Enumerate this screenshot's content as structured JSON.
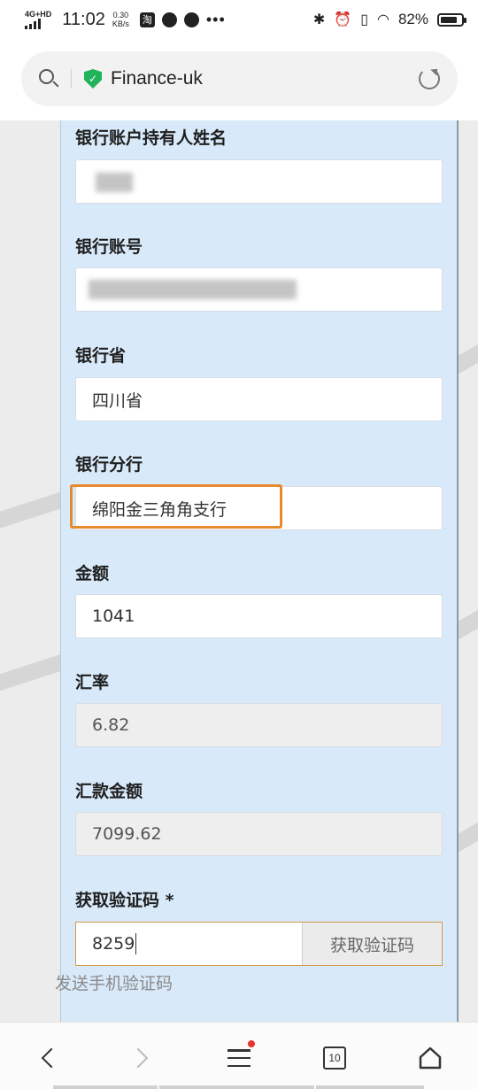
{
  "status_bar": {
    "network": "4G+HD",
    "time": "11:02",
    "speed_value": "0.30",
    "speed_unit": "KB/s",
    "taobao_glyph": "淘",
    "more": "•••",
    "battery": "82%",
    "battery_level": 0.82,
    "icons": [
      "signal-icon",
      "taobao-icon",
      "compass-icon",
      "chat-icon",
      "bluetooth-icon",
      "alarm-icon",
      "vibrate-icon",
      "wifi-icon",
      "battery-icon"
    ]
  },
  "browser": {
    "url": "Finance-uk",
    "secure_glyph": "✓"
  },
  "form": {
    "account_holder": {
      "label": "银行账户持有人姓名",
      "value": ""
    },
    "account_number": {
      "label": "银行账号",
      "value": ""
    },
    "province": {
      "label": "银行省",
      "value": "四川省"
    },
    "branch": {
      "label": "银行分行",
      "value": "绵阳金三角角支行"
    },
    "amount": {
      "label": "金额",
      "value": "1041"
    },
    "rate": {
      "label": "汇率",
      "value": "6.82"
    },
    "remit_amount": {
      "label": "汇款金额",
      "value": "7099.62"
    },
    "captcha": {
      "label": "获取验证码 *",
      "value": "8259",
      "button": "获取验证码",
      "hint": "发送手机验证码"
    }
  },
  "bottom_nav": {
    "tab_count": "10"
  },
  "colors": {
    "panel": "#d8e9f9",
    "highlight": "#e78a2e",
    "secure": "#1fb35a",
    "badge": "#e8322b"
  }
}
